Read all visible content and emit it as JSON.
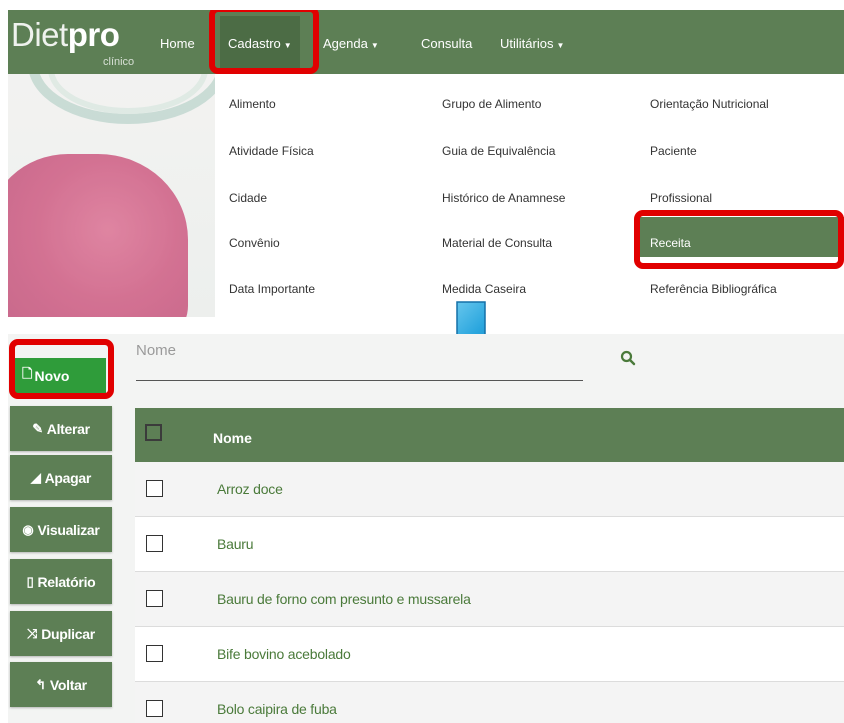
{
  "brand": {
    "name_light": "Diet",
    "name_bold": "pro",
    "subtitle": "clínico"
  },
  "nav": {
    "home": "Home",
    "cadastro": "Cadastro",
    "agenda": "Agenda",
    "consulta": "Consulta",
    "utilitarios": "Utilitários"
  },
  "cadastro_menu": {
    "col1": [
      "Alimento",
      "Atividade Física",
      "Cidade",
      "Convênio",
      "Data Importante"
    ],
    "col2": [
      "Grupo de Alimento",
      "Guia de Equivalência",
      "Histórico de Anamnese",
      "Material de Consulta",
      "Medida Caseira"
    ],
    "col3": [
      "Orientação Nutricional",
      "Paciente",
      "Profissional",
      "Receita",
      "Referência Bibliográfica"
    ],
    "active_item": "Receita"
  },
  "actions": {
    "novo": "Novo",
    "alterar": "Alterar",
    "apagar": "Apagar",
    "visualizar": "Visualizar",
    "relatorio": "Relatório",
    "duplicar": "Duplicar",
    "voltar": "Voltar"
  },
  "search": {
    "label": "Nome"
  },
  "table": {
    "header": "Nome",
    "rows": [
      "Arroz doce",
      "Bauru",
      "Bauru de forno com presunto e mussarela",
      "Bife bovino acebolado",
      "Bolo caipira de fuba"
    ]
  },
  "colors": {
    "primary_green": "#5d7f55",
    "novo_green": "#2f9c3a",
    "highlight_red": "#e10000",
    "arrow_blue": "#2a9fd6",
    "row_text_green": "#4a7a3a"
  },
  "icons": {
    "novo": "file-icon",
    "alterar": "edit-icon",
    "apagar": "eraser-icon",
    "visualizar": "eye-icon",
    "relatorio": "pdf-icon",
    "duplicar": "shuffle-icon",
    "voltar": "back-arrow-icon",
    "search": "search-icon"
  }
}
